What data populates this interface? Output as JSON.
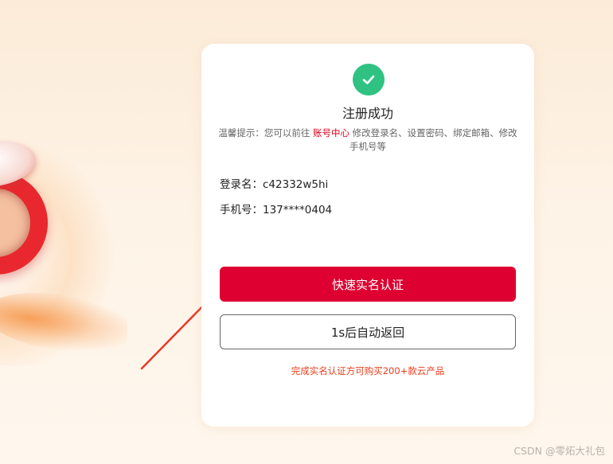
{
  "card": {
    "title": "注册成功",
    "tip_prefix": "温馨提示：您可以前往 ",
    "tip_link": "账号中心",
    "tip_suffix": " 修改登录名、设置密码、绑定邮箱、修改手机号等",
    "login_label": "登录名：",
    "login_value": "c42332w5hi",
    "phone_label": "手机号：",
    "phone_value": "137****0404",
    "primary_button": "快速实名认证",
    "secondary_button": "1s后自动返回",
    "note": "完成实名认证方可购买200+款云产品"
  },
  "watermark": "CSDN @零炻大礼包",
  "colors": {
    "accent": "#dd0031",
    "success": "#2fc282",
    "arrow": "#e8392a"
  },
  "icons": {
    "success": "check-circle-icon"
  }
}
